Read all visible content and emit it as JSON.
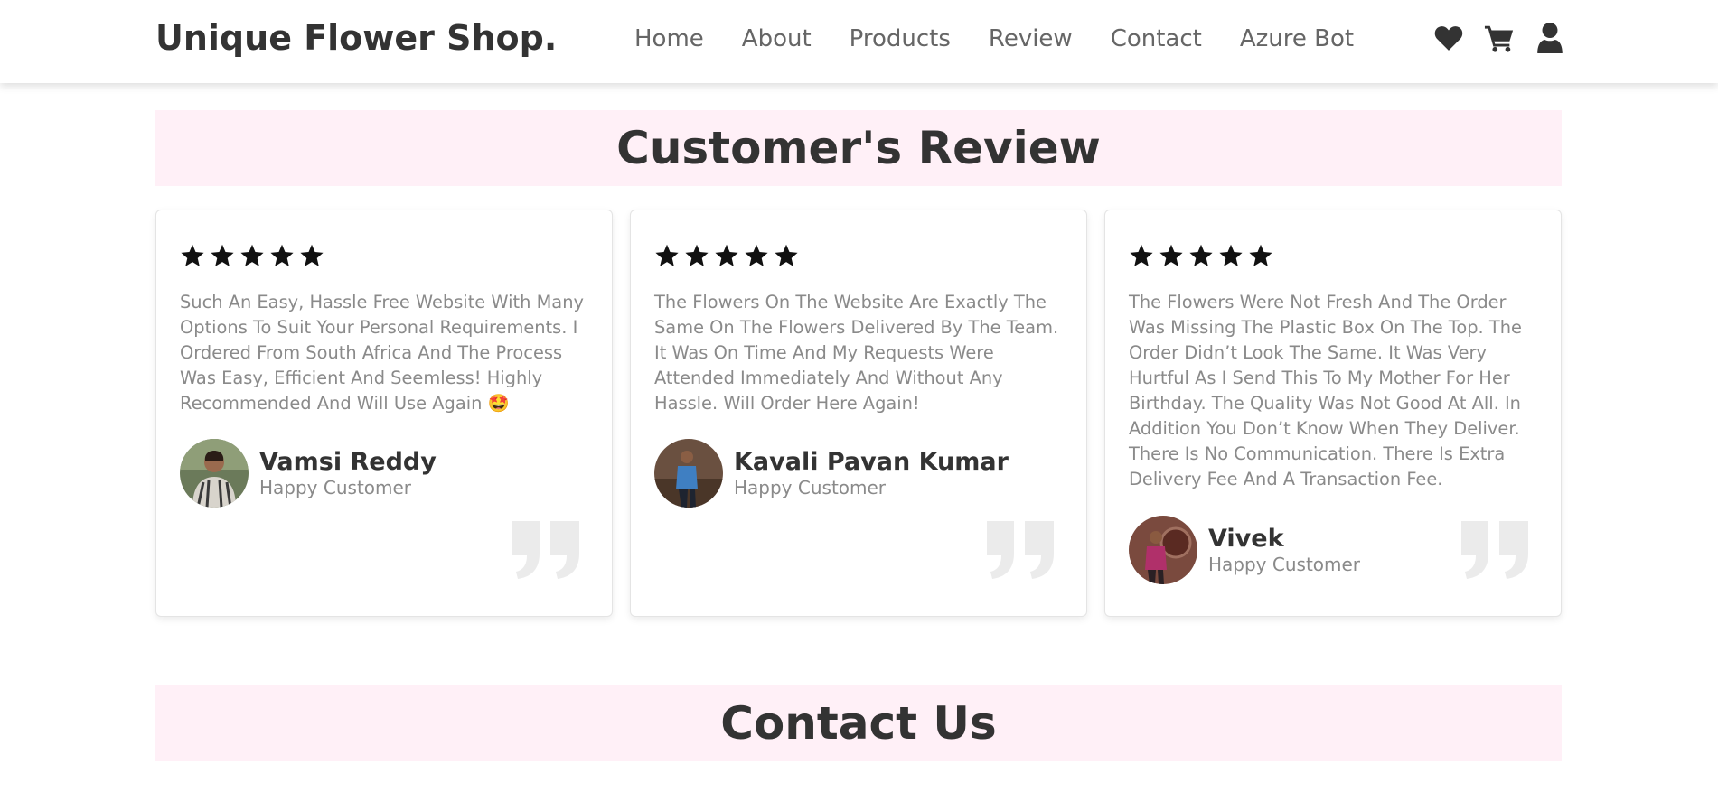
{
  "header": {
    "logo": "Unique Flower Shop.",
    "nav": [
      "Home",
      "About",
      "Products",
      "Review",
      "Contact",
      "Azure Bot"
    ],
    "icons": [
      "heart-icon",
      "shopping-cart-icon",
      "user-icon"
    ]
  },
  "review_section": {
    "heading": "Customer's Review",
    "reviews": [
      {
        "rating": 5,
        "text": "Such An Easy, Hassle Free Website With Many Options To Suit Your Personal Requirements. I Ordered From South Africa And The Process Was Easy, Efficient And Seemless! Highly Recommended And Will Use Again 🤩",
        "name": "Vamsi Reddy",
        "role": "Happy Customer"
      },
      {
        "rating": 5,
        "text": "The Flowers On The Website Are Exactly The Same On The Flowers Delivered By The Team. It Was On Time And My Requests Were Attended Immediately And Without Any Hassle. Will Order Here Again!",
        "name": "Kavali Pavan Kumar",
        "role": "Happy Customer"
      },
      {
        "rating": 5,
        "text": "The Flowers Were Not Fresh And The Order Was Missing The Plastic Box On The Top. The Order Didn’t Look The Same. It Was Very Hurtful As I Send This To My Mother For Her Birthday. The Quality Was Not Good At All. In Addition You Don’t Know When They Deliver. There Is No Communication. There Is Extra Delivery Fee And A Transaction Fee.",
        "name": "Vivek",
        "role": "Happy Customer"
      }
    ]
  },
  "contact_section": {
    "heading": "Contact Us"
  },
  "colors": {
    "heading_band": "#fff0f7",
    "text_dark": "#333333",
    "text_muted": "#8a8a8a"
  }
}
